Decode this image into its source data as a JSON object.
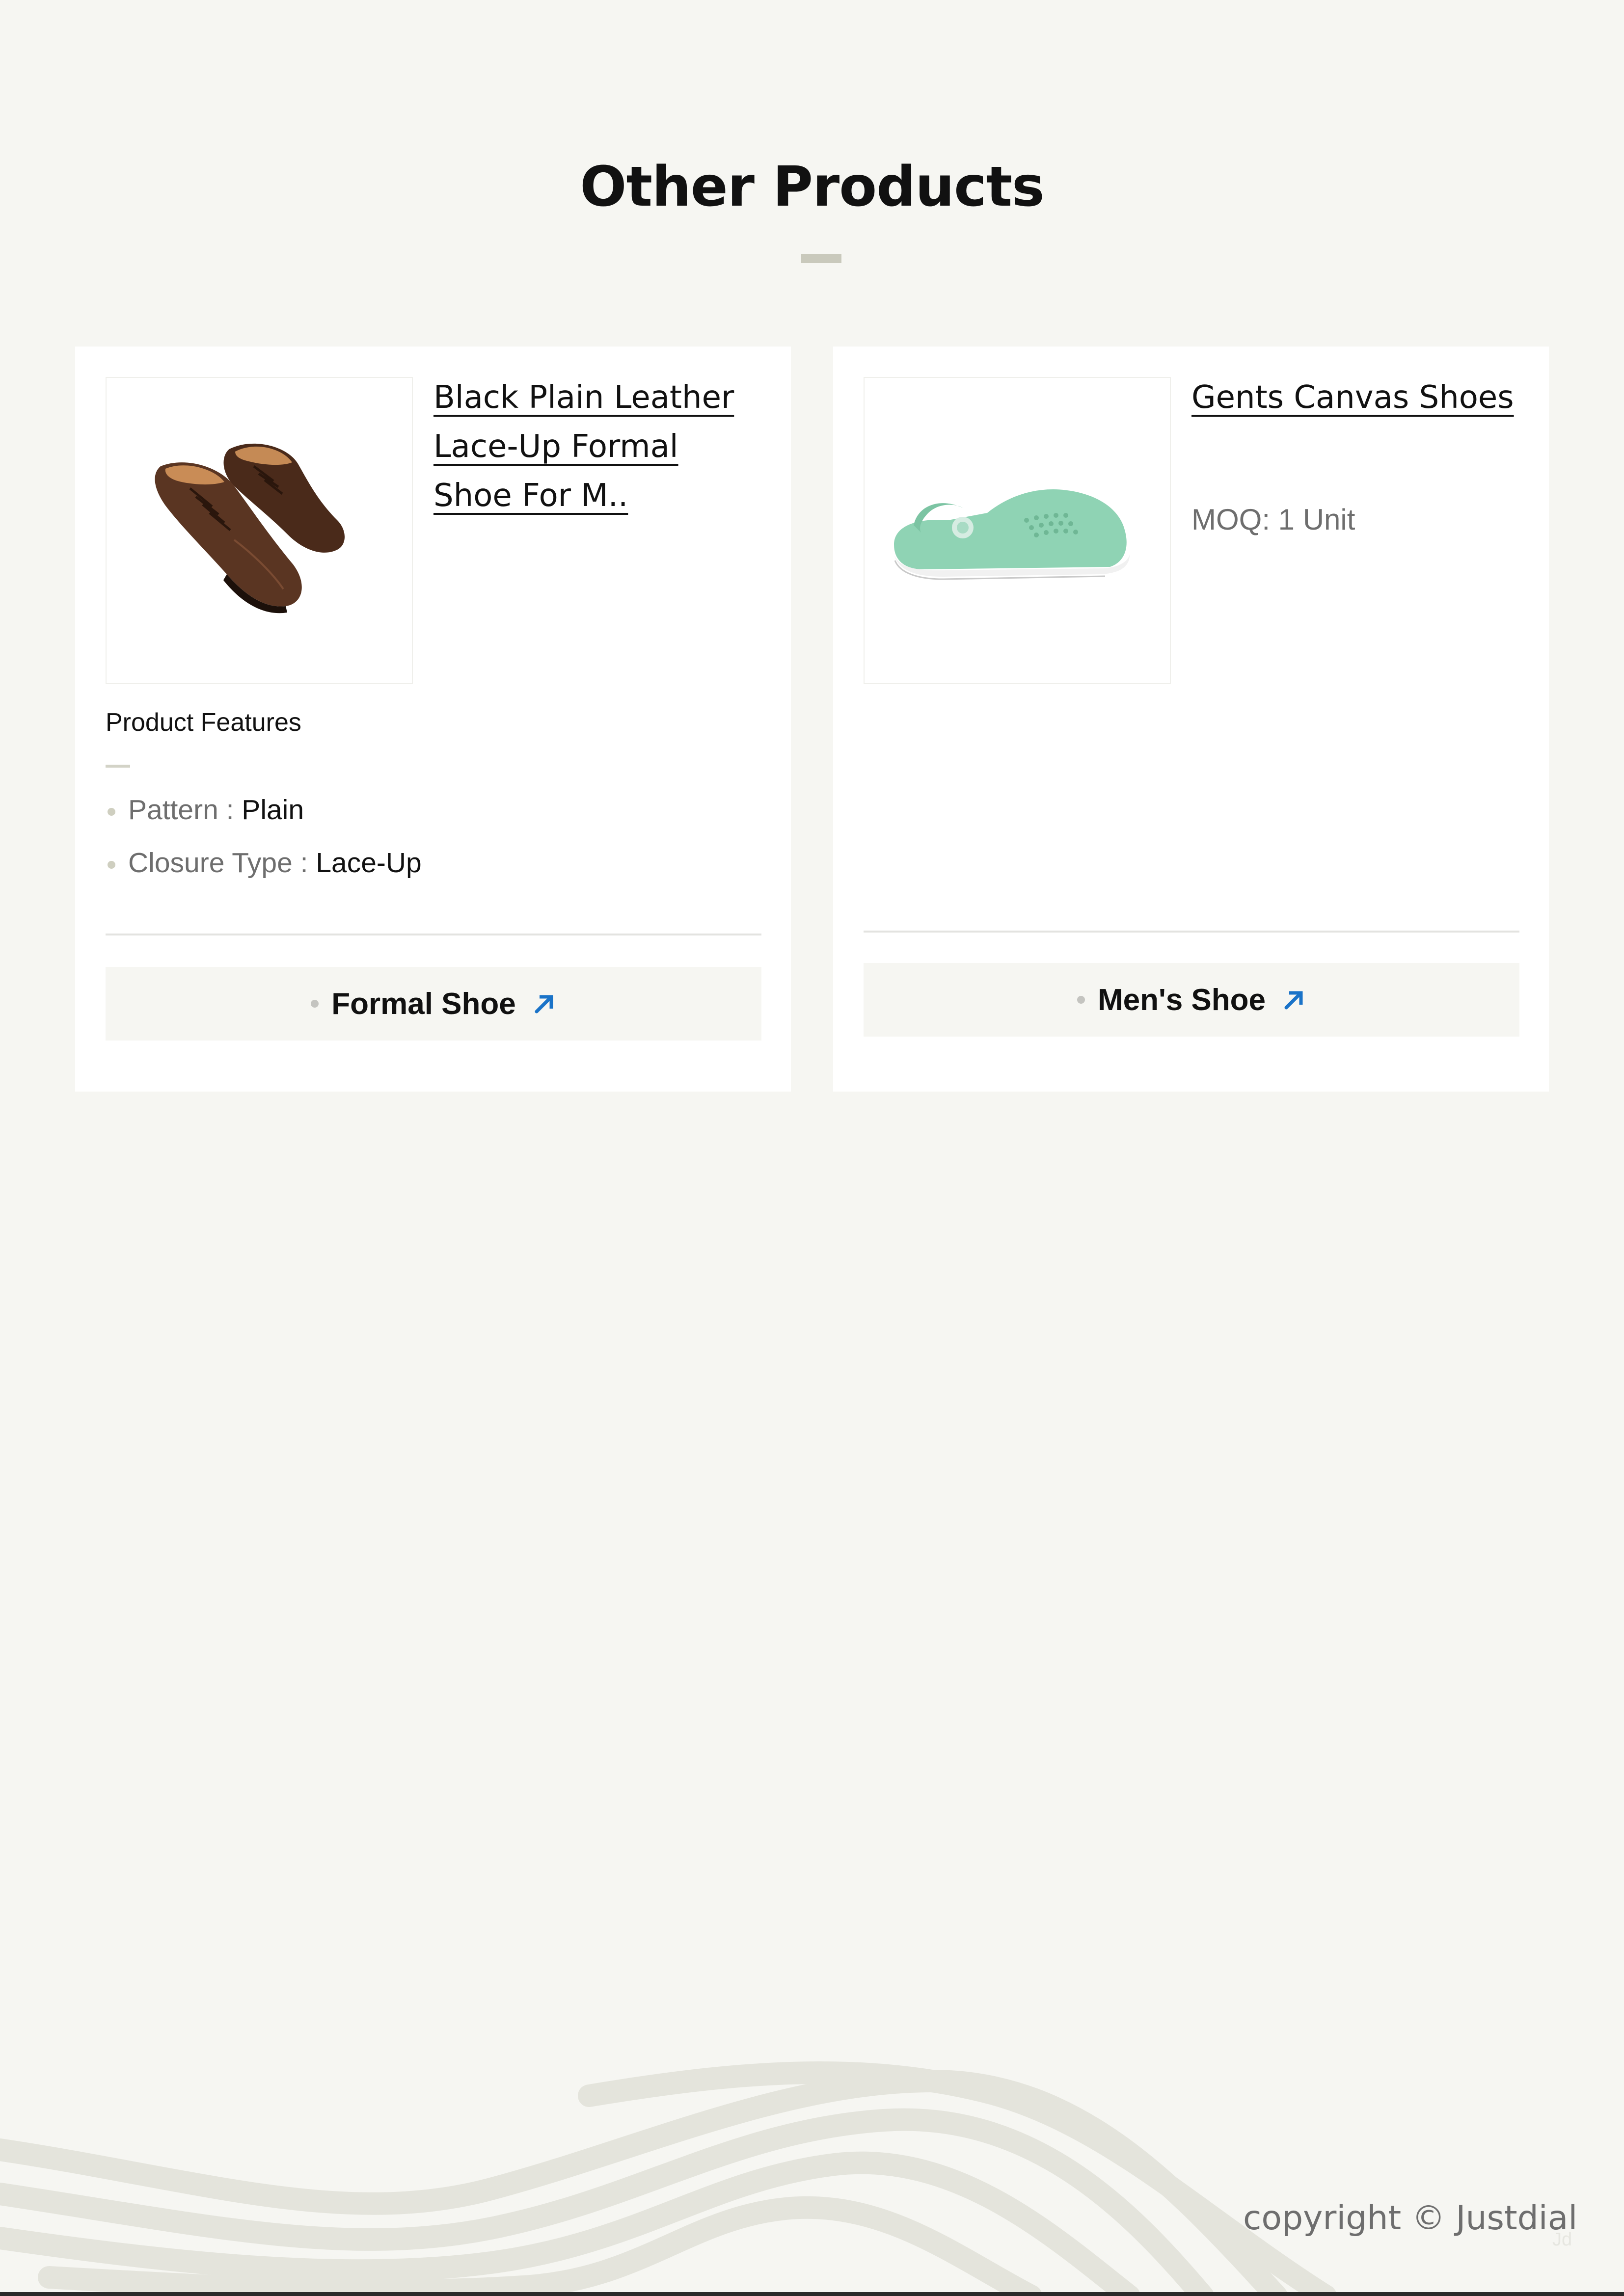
{
  "section": {
    "title": "Other Products"
  },
  "products": [
    {
      "name": "Black Plain Leather Lace-Up Formal Shoe For M..",
      "features_title": "Product Features",
      "features": [
        {
          "key": "Pattern : ",
          "value": "Plain"
        },
        {
          "key": "Closure Type : ",
          "value": "Lace-Up"
        }
      ],
      "category": "Formal Shoe",
      "image_icon": "formal-shoe-image"
    },
    {
      "name": "Gents Canvas Shoes",
      "moq": "MOQ: 1 Unit",
      "category": "Men's Shoe",
      "image_icon": "clog-shoe-image"
    }
  ],
  "footer": {
    "copyright": "copyright © Justdial",
    "mark": "Jd"
  },
  "colors": {
    "background": "#f6f6f2",
    "accent_link": "#1a73c8",
    "shoe_brown": "#5a3522",
    "clog_mint": "#8fd3b4"
  }
}
